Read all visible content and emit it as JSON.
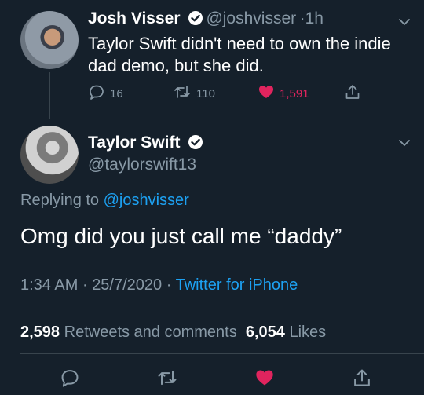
{
  "parent_tweet": {
    "author_name": "Josh Visser",
    "author_handle": "@joshvisser",
    "separator": "·",
    "time": "1h",
    "text_line1": "Taylor Swift didn't need to own the indie",
    "text_line2": "dad demo, but she did.",
    "replies": "16",
    "retweets": "110",
    "likes": "1,591"
  },
  "main_tweet": {
    "author_name": "Taylor Swift",
    "author_handle": "@taylorswift13",
    "replying_prefix": "Replying to",
    "replying_to": "@joshvisser",
    "text": "Omg did you just call me “daddy”",
    "time": "1:34 AM",
    "date": "25/7/2020",
    "dot": "·",
    "source": "Twitter for iPhone",
    "retweets_count": "2,598",
    "retweets_label": "Retweets and comments",
    "likes_count": "6,054",
    "likes_label": "Likes"
  },
  "colors": {
    "background": "#15202b",
    "link": "#1da1f2",
    "muted": "#8899a6",
    "like": "#e0245e"
  },
  "icons": {
    "reply": "reply-icon",
    "retweet": "retweet-icon",
    "like": "heart-icon",
    "share": "share-icon",
    "verified": "verified-badge-icon",
    "more": "chevron-down-icon"
  }
}
